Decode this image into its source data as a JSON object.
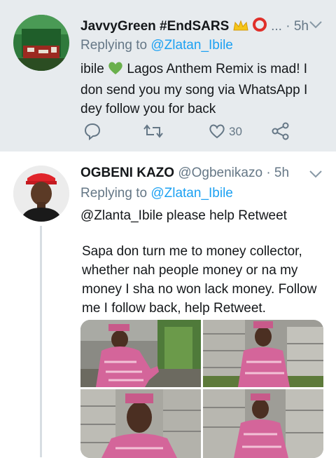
{
  "tweets": [
    {
      "display_name": "JavvyGreen #EndSARS",
      "name_emojis": [
        "crown-emoji",
        "red-circle-emoji"
      ],
      "name_ellipsis": "...",
      "time": "· 5h",
      "replying_prefix": "Replying to ",
      "replying_to": "@Zlatan_Ibile",
      "text_before_emoji": "ibile ",
      "text_emoji": "green-heart-emoji",
      "text_after_emoji": " Lagos Anthem Remix is mad! I don send you my song via WhatsApp I dey follow you for back",
      "actions": {
        "reply_icon": "comment-icon",
        "retweet_icon": "retweet-icon",
        "like_icon": "heart-icon",
        "like_count": "30",
        "share_icon": "share-icon"
      }
    },
    {
      "display_name": "OGBENI KAZO",
      "handle": "@Ogbenikazo",
      "time": "· 5h",
      "replying_prefix": "Replying to ",
      "replying_to": "@Zlatan_Ibile",
      "text_line1": "@Zlanta_Ibile please help Retweet",
      "text_paragraph": "Sapa don turn me to money collector, whether nah people money or na my money I sha no won lack money. Follow me I follow back, help Retweet."
    }
  ],
  "colors": {
    "mention": "#1da1f2",
    "muted": "#657786",
    "highlight_bg": "#e7ebee"
  }
}
